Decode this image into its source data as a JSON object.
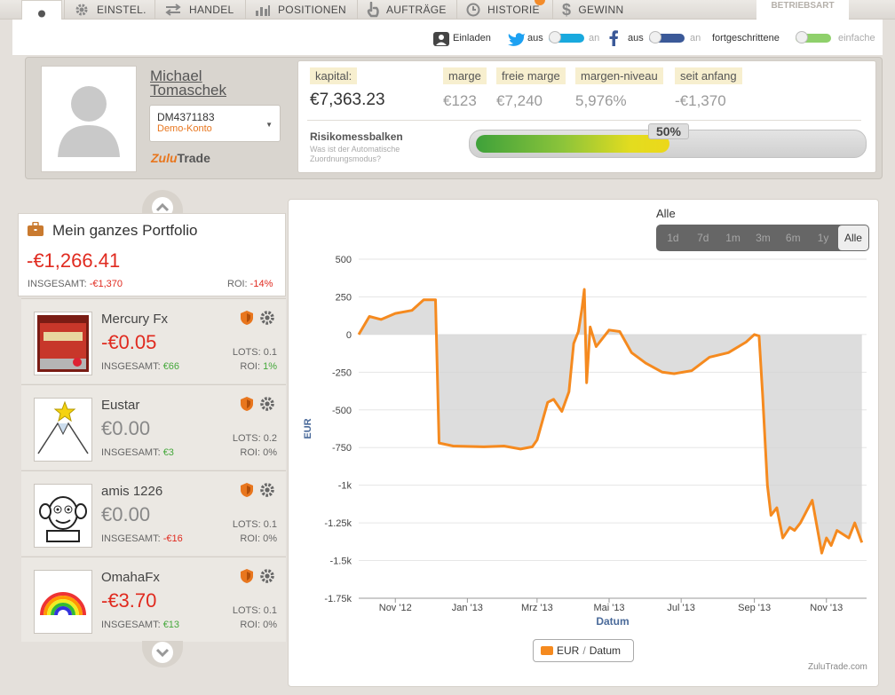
{
  "nav": {
    "tabs": [
      {
        "label": "EINSTEL.",
        "icon": "gear-icon"
      },
      {
        "label": "HANDEL",
        "icon": "swap-arrows-icon"
      },
      {
        "label": "POSITIONEN",
        "icon": "bar-chart-icon"
      },
      {
        "label": "AUFTRÄGE",
        "icon": "hand-icon"
      },
      {
        "label": "HISTORIE",
        "icon": "clock-icon"
      },
      {
        "label": "GEWINN",
        "icon": "dollar-icon"
      }
    ],
    "mode_label": "BETRIEBSART"
  },
  "toggles": {
    "invite": "Einladen",
    "twitter_on": "aus",
    "twitter_off": "an",
    "facebook_on": "aus",
    "facebook_off": "an",
    "advanced": "fortgeschrittene",
    "simple": "einfache"
  },
  "profile": {
    "name": "Michael Tomaschek",
    "account_id": "DM4371183",
    "account_type": "Demo-Konto",
    "brand_z": "Zulu",
    "brand_rest": "Trade"
  },
  "stats": {
    "kapital_label": "kapital:",
    "kapital_value": "€7,363.23",
    "marge_label": "marge",
    "marge_value": "€123",
    "freie_label": "freie marge",
    "freie_value": "€7,240",
    "niveau_label": "margen-niveau",
    "niveau_value": "5,976%",
    "seit_label": "seit anfang",
    "seit_value": "-€1,370",
    "risk_title": "Risikomessbalken",
    "risk_sub": "Was ist der Automatische Zuordnungsmodus?",
    "risk_pct": "50%",
    "risk_level": 0.5
  },
  "portfolio": {
    "title": "Mein ganzes Portfolio",
    "value": "-€1,266.41",
    "total_label": "INSGESAMT: ",
    "total_value": "-€1,370",
    "roi_label": "ROI: ",
    "roi_value": "-14%"
  },
  "traders": [
    {
      "name": "Mercury Fx",
      "value": "-€0.05",
      "total_label": "INSGESAMT: ",
      "total": "€66",
      "lots": "LOTS: 0.1",
      "roi_label": "ROI: ",
      "roi": "1%"
    },
    {
      "name": "Eustar",
      "value": "€0.00",
      "total_label": "INSGESAMT: ",
      "total": "€3",
      "lots": "LOTS: 0.2",
      "roi_label": "ROI: ",
      "roi": "0%"
    },
    {
      "name": "amis 1226",
      "value": "€0.00",
      "total_label": "INSGESAMT: ",
      "total": "-€16",
      "lots": "LOTS: 0.1",
      "roi_label": "ROI: ",
      "roi": "0%"
    },
    {
      "name": "OmahaFx",
      "value": "-€3.70",
      "total_label": "INSGESAMT: ",
      "total": "€13",
      "lots": "LOTS: 0.1",
      "roi_label": "ROI: ",
      "roi": "0%"
    }
  ],
  "range": {
    "label": "Alle",
    "buttons": [
      "1d",
      "7d",
      "1m",
      "3m",
      "6m",
      "1y",
      "Alle"
    ],
    "active": "Alle"
  },
  "chart_data": {
    "type": "area",
    "ylabel": "EUR",
    "xlabel": "Datum",
    "ylim": [
      -1750,
      500
    ],
    "yticks": [
      "500",
      "250",
      "0",
      "-250",
      "-500",
      "-750",
      "-1k",
      "-1.25k",
      "-1.5k",
      "-1.75k"
    ],
    "xticks": [
      "Nov '12",
      "Jan '13",
      "Mrz '13",
      "Mai '13",
      "Jul '13",
      "Sep '13",
      "Nov '13"
    ],
    "x": [
      "2012-10-01",
      "2012-10-10",
      "2012-10-20",
      "2012-11-01",
      "2012-11-15",
      "2012-11-25",
      "2012-12-05",
      "2012-12-08",
      "2012-12-20",
      "2013-01-15",
      "2013-02-01",
      "2013-02-15",
      "2013-02-25",
      "2013-03-01",
      "2013-03-10",
      "2013-03-15",
      "2013-03-22",
      "2013-03-28",
      "2013-04-01",
      "2013-04-05",
      "2013-04-08",
      "2013-04-10",
      "2013-04-12",
      "2013-04-15",
      "2013-04-20",
      "2013-05-01",
      "2013-05-10",
      "2013-05-20",
      "2013-06-01",
      "2013-06-15",
      "2013-06-25",
      "2013-07-10",
      "2013-07-25",
      "2013-08-10",
      "2013-08-25",
      "2013-09-01",
      "2013-09-05",
      "2013-09-08",
      "2013-09-12",
      "2013-09-15",
      "2013-09-20",
      "2013-09-25",
      "2013-10-01",
      "2013-10-05",
      "2013-10-10",
      "2013-10-20",
      "2013-10-28",
      "2013-11-01",
      "2013-11-05",
      "2013-11-10",
      "2013-11-20",
      "2013-11-25",
      "2013-12-01"
    ],
    "series": [
      {
        "name": "EUR",
        "values": [
          0,
          120,
          100,
          140,
          160,
          230,
          230,
          -720,
          -740,
          -745,
          -740,
          -760,
          -745,
          -700,
          -450,
          -430,
          -510,
          -380,
          -60,
          20,
          170,
          300,
          -320,
          50,
          -80,
          30,
          20,
          -120,
          -190,
          -250,
          -260,
          -240,
          -150,
          -120,
          -50,
          0,
          -10,
          -400,
          -1000,
          -1200,
          -1150,
          -1350,
          -1280,
          -1300,
          -1250,
          -1100,
          -1450,
          -1350,
          -1400,
          -1300,
          -1350,
          -1250,
          -1380
        ]
      }
    ],
    "fill_color": "#d5d5d5",
    "line_color": "#f58a1f"
  },
  "chart_footer": {
    "legend_name": "EUR",
    "legend_sep": "/",
    "legend_axis": "Datum",
    "credit": "ZuluTrade.com"
  }
}
